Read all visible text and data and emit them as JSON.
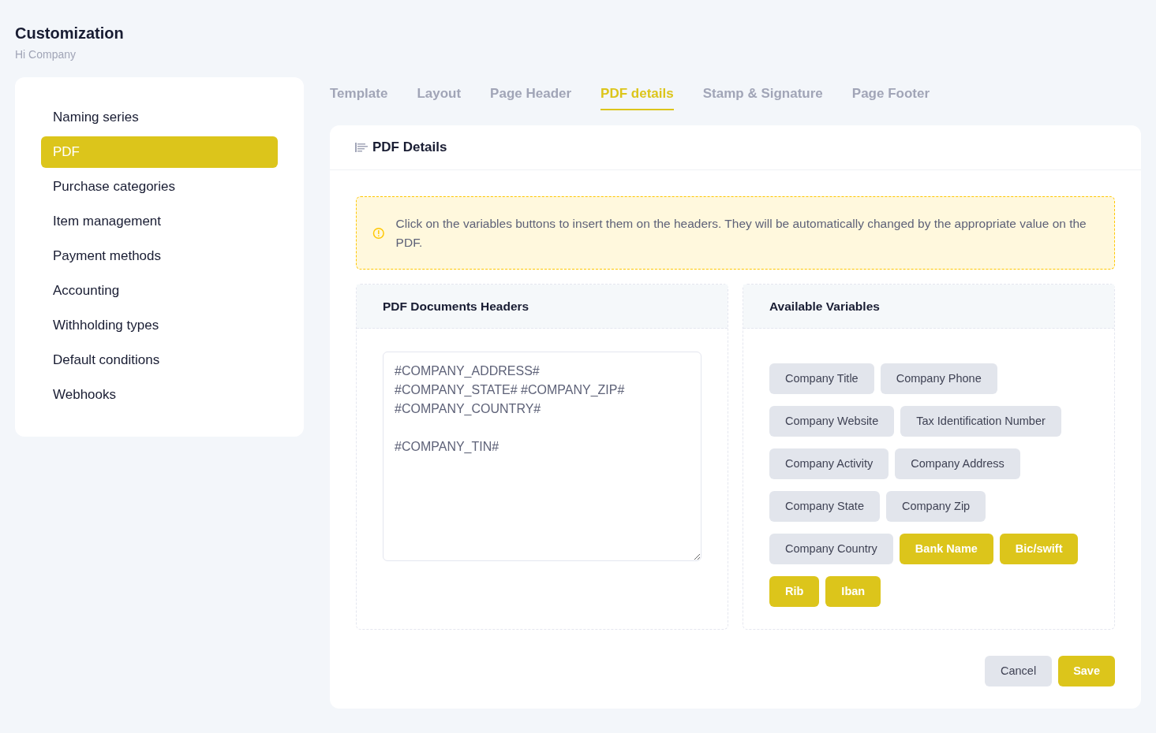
{
  "header": {
    "title": "Customization",
    "subtitle": "Hi Company"
  },
  "sidebar": {
    "items": [
      {
        "label": "Naming series",
        "selected": false
      },
      {
        "label": "PDF",
        "selected": true
      },
      {
        "label": "Purchase categories",
        "selected": false
      },
      {
        "label": "Item management",
        "selected": false
      },
      {
        "label": "Payment methods",
        "selected": false
      },
      {
        "label": "Accounting",
        "selected": false
      },
      {
        "label": "Withholding types",
        "selected": false
      },
      {
        "label": "Default conditions",
        "selected": false
      },
      {
        "label": "Webhooks",
        "selected": false
      }
    ]
  },
  "tabs": [
    {
      "label": "Template",
      "selected": false
    },
    {
      "label": "Layout",
      "selected": false
    },
    {
      "label": "Page Header",
      "selected": false
    },
    {
      "label": "PDF details",
      "selected": true
    },
    {
      "label": "Stamp & Signature",
      "selected": false
    },
    {
      "label": "Page Footer",
      "selected": false
    }
  ],
  "card": {
    "title": "PDF Details",
    "notice": "Click on the variables buttons to insert them on the headers. They will be automatically changed by the appropriate value on the PDF.",
    "headers_panel": {
      "title": "PDF Documents Headers",
      "value": "#COMPANY_ADDRESS#\n#COMPANY_STATE# #COMPANY_ZIP#\n#COMPANY_COUNTRY#\n\n#COMPANY_TIN#"
    },
    "variables_panel": {
      "title": "Available Variables",
      "variables": [
        {
          "label": "Company Title",
          "kind": "company"
        },
        {
          "label": "Company Phone",
          "kind": "company"
        },
        {
          "label": "Company Website",
          "kind": "company"
        },
        {
          "label": "Tax Identification Number",
          "kind": "company"
        },
        {
          "label": "Company Activity",
          "kind": "company"
        },
        {
          "label": "Company Address",
          "kind": "company"
        },
        {
          "label": "Company State",
          "kind": "company"
        },
        {
          "label": "Company Zip",
          "kind": "company"
        },
        {
          "label": "Company Country",
          "kind": "company"
        },
        {
          "label": "Bank Name",
          "kind": "bank"
        },
        {
          "label": "Bic/swift",
          "kind": "bank"
        },
        {
          "label": "Rib",
          "kind": "bank"
        },
        {
          "label": "Iban",
          "kind": "bank"
        }
      ]
    },
    "buttons": {
      "cancel": "Cancel",
      "save": "Save"
    }
  }
}
